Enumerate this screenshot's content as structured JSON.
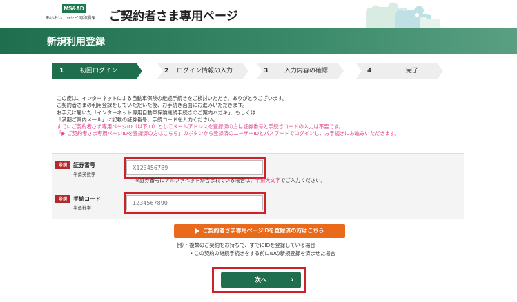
{
  "header": {
    "logo_brand": "MS&AD",
    "logo_company": "あいおいニッセイ同和損保",
    "site_title": "ご契約者さま専用ページ"
  },
  "band": {
    "title": "新規利用登録"
  },
  "steps": [
    {
      "num": "1",
      "label": "初回ログイン",
      "active": true
    },
    {
      "num": "2",
      "label": "ログイン情報の入力",
      "active": false
    },
    {
      "num": "3",
      "label": "入力内容の確認",
      "active": false
    },
    {
      "num": "4",
      "label": "完了",
      "active": false
    }
  ],
  "intro": {
    "line1": "この度は、インターネットによる自動車保険の継続手続きをご検討いただき、ありがとうございます。",
    "line2": "ご契約者さまの利用登録をしていただいた後、お手続き画面にお進みいただきます。",
    "line3": "お手元に届いた「インターネット専用自動車保険継続手続きのご案内ハガキ」、もしくは",
    "line4": "「満期ご案内メール」に記載の証券番号、手続コードを入力ください。",
    "line5": "すでにご契約者さま専用ページID（以下ID）としてメールアドレスを登録済の方は証券番号と手続きコードの入力は不要です。",
    "line6": "「▶ ご契約者さま専用ページIDを登録済の方はこちら」のボタンから登録済のユーザーIDとパスワードでログインし、お手続きにお進みいただきます。"
  },
  "form": {
    "required_label": "必須",
    "policy_label": "証券番号",
    "policy_sub": "半角英数字",
    "policy_placeholder": "X123456789",
    "note_prefix": "※証券番号にアルファベットが含まれている場合は、",
    "note_pink": "半角大文字",
    "note_suffix": "でご入力ください。",
    "code_label": "手続コード",
    "code_sub": "半角数字",
    "code_placeholder": "1234567890"
  },
  "id_button": {
    "label": "ご契約者さま専用ページIDを登録済の方はこちら"
  },
  "examples": {
    "line1": "例）・複数のご契約をお持ちで、すでにIDを登録している場合",
    "line2": "・この契約の継続手続きをする前にIDの新規登録を済ませた場合"
  },
  "next_button": {
    "label": "次へ"
  },
  "colors": {
    "brand_green": "#1f6e4e",
    "accent_orange": "#e86a1a",
    "required_red": "#b5282e",
    "highlight_red": "#d0202a",
    "notice_pink": "#e0408a"
  }
}
